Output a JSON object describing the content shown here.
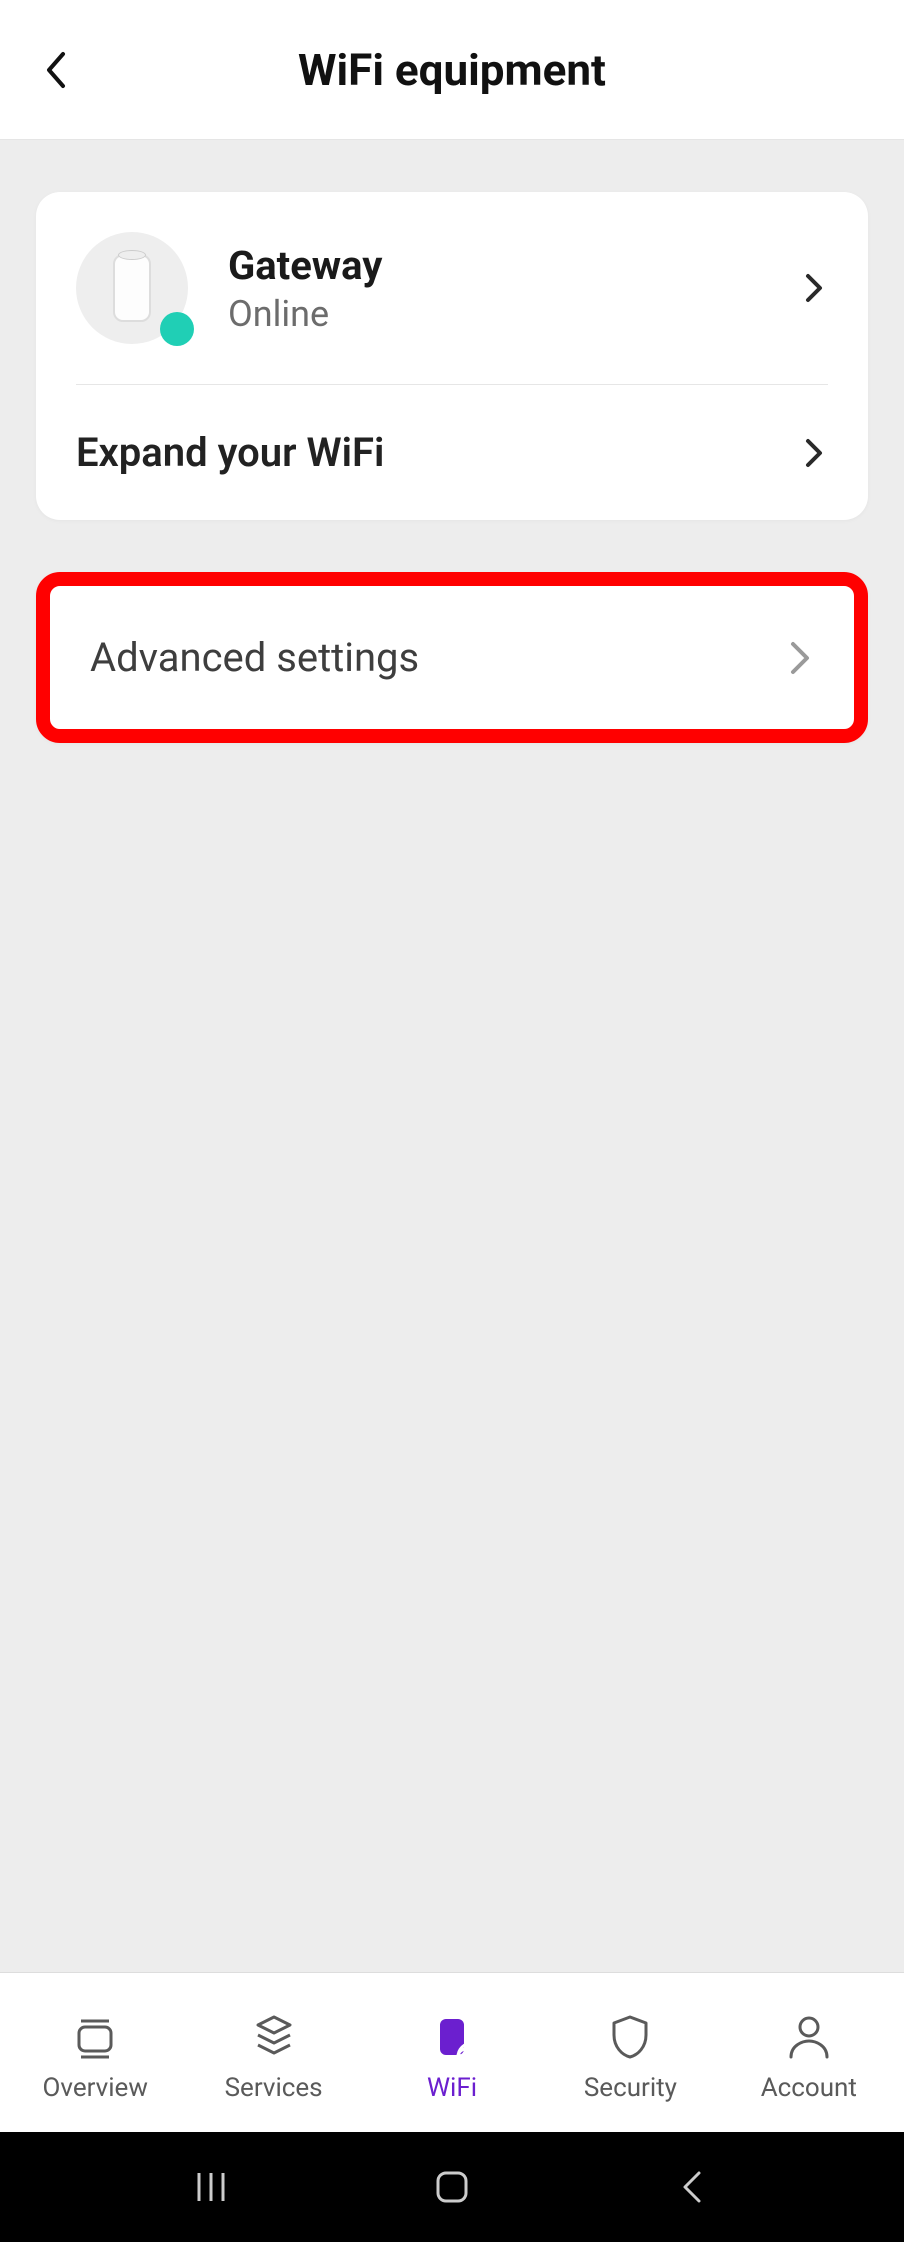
{
  "header": {
    "title": "WiFi equipment"
  },
  "gateway": {
    "title": "Gateway",
    "status": "Online",
    "status_color": "#20cfb5"
  },
  "expand": {
    "label": "Expand your WiFi"
  },
  "advanced": {
    "label": "Advanced settings"
  },
  "nav": {
    "items": [
      {
        "label": "Overview",
        "icon": "overview-icon"
      },
      {
        "label": "Services",
        "icon": "services-icon"
      },
      {
        "label": "WiFi",
        "icon": "wifi-icon",
        "active": true
      },
      {
        "label": "Security",
        "icon": "security-icon"
      },
      {
        "label": "Account",
        "icon": "account-icon"
      }
    ]
  }
}
